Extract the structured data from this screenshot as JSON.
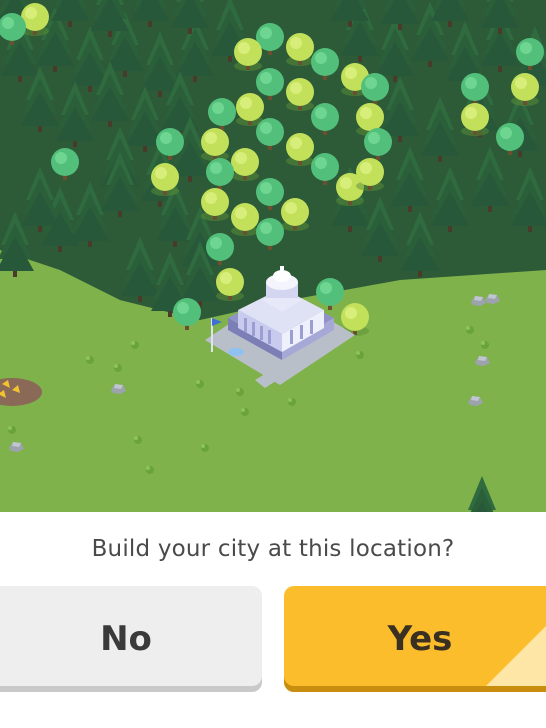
{
  "prompt": {
    "question": "Build your city at this location?",
    "no_label": "No",
    "yes_label": "Yes"
  },
  "colors": {
    "grass": "#7fb24a",
    "yes_button": "#fbbd2c",
    "no_button": "#eeeeee",
    "text": "#4a4a4a"
  },
  "scene": {
    "landmark": "town-hall-icon",
    "terrain": "forest-icon"
  }
}
